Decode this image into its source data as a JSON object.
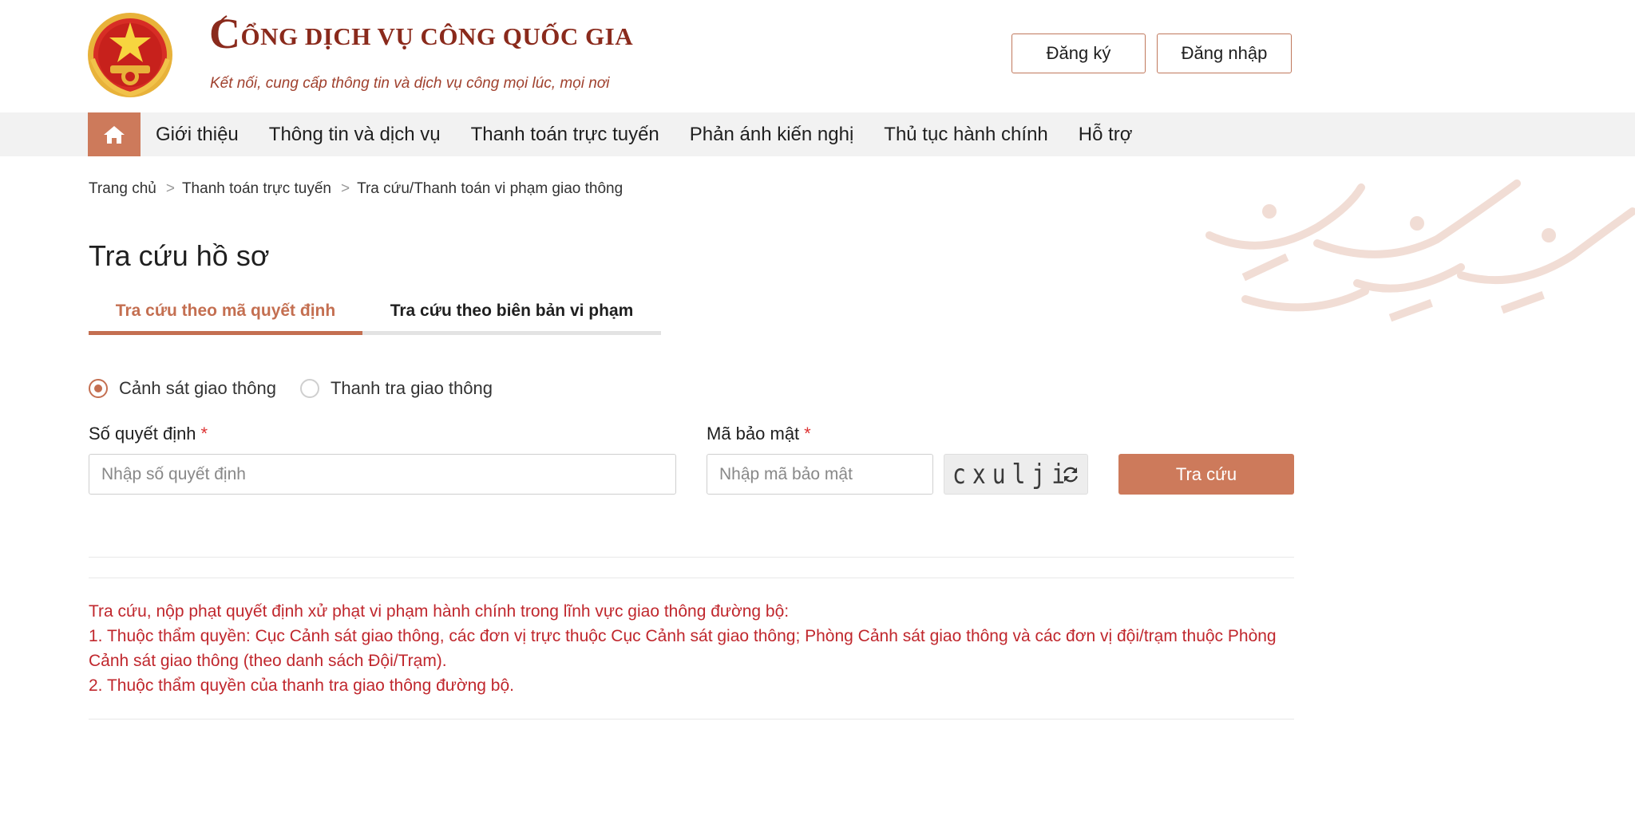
{
  "header": {
    "brand_title_initial": "C",
    "brand_title_rest": "ỔNG DỊCH VỤ CÔNG QUỐC GIA",
    "brand_subtitle": "Kết nối, cung cấp thông tin và dịch vụ công mọi lúc, mọi nơi",
    "register_label": "Đăng ký",
    "login_label": "Đăng nhập"
  },
  "nav": {
    "home_icon": "home-icon",
    "items": [
      {
        "label": "Giới thiệu"
      },
      {
        "label": "Thông tin và dịch vụ"
      },
      {
        "label": "Thanh toán trực tuyến"
      },
      {
        "label": "Phản ánh kiến nghị"
      },
      {
        "label": "Thủ tục hành chính"
      },
      {
        "label": "Hỗ trợ"
      }
    ]
  },
  "breadcrumb": {
    "separator": ">",
    "items": [
      {
        "label": "Trang chủ"
      },
      {
        "label": "Thanh toán trực tuyến"
      },
      {
        "label": "Tra cứu/Thanh toán vi phạm giao thông"
      }
    ]
  },
  "page_title": "Tra cứu hồ sơ",
  "tabs": [
    {
      "label": "Tra cứu theo mã quyết định",
      "active": true
    },
    {
      "label": "Tra cứu theo biên bản vi phạm",
      "active": false
    }
  ],
  "agency_options": [
    {
      "label": "Cảnh sát giao thông",
      "checked": true
    },
    {
      "label": "Thanh tra giao thông",
      "checked": false
    }
  ],
  "form": {
    "decision_label": "Số quyết định",
    "decision_placeholder": "Nhập số quyết định",
    "decision_value": "",
    "captcha_label": "Mã bảo mật",
    "captcha_placeholder": "Nhập mã bảo mật",
    "captcha_value": "",
    "required_mark": "*",
    "captcha_image_text": "cxulji",
    "refresh_icon": "refresh-icon",
    "search_button_label": "Tra cứu"
  },
  "notes": [
    "Tra cứu, nộp phạt quyết định xử phạt vi phạm hành chính trong lĩnh vực giao thông đường bộ:",
    "1. Thuộc thẩm quyền: Cục Cảnh sát giao thông, các đơn vị trực thuộc Cục Cảnh sát giao thông; Phòng Cảnh sát giao thông và các đơn vị đội/trạm thuộc Phòng Cảnh sát giao thông (theo danh sách Đội/Trạm).",
    "2. Thuộc thẩm quyền của thanh tra giao thông đường bộ."
  ],
  "colors": {
    "accent": "#cd7a5b",
    "brand": "#8a2a1c",
    "note_text": "#c0272d",
    "nav_bg": "#f2f2f2"
  }
}
